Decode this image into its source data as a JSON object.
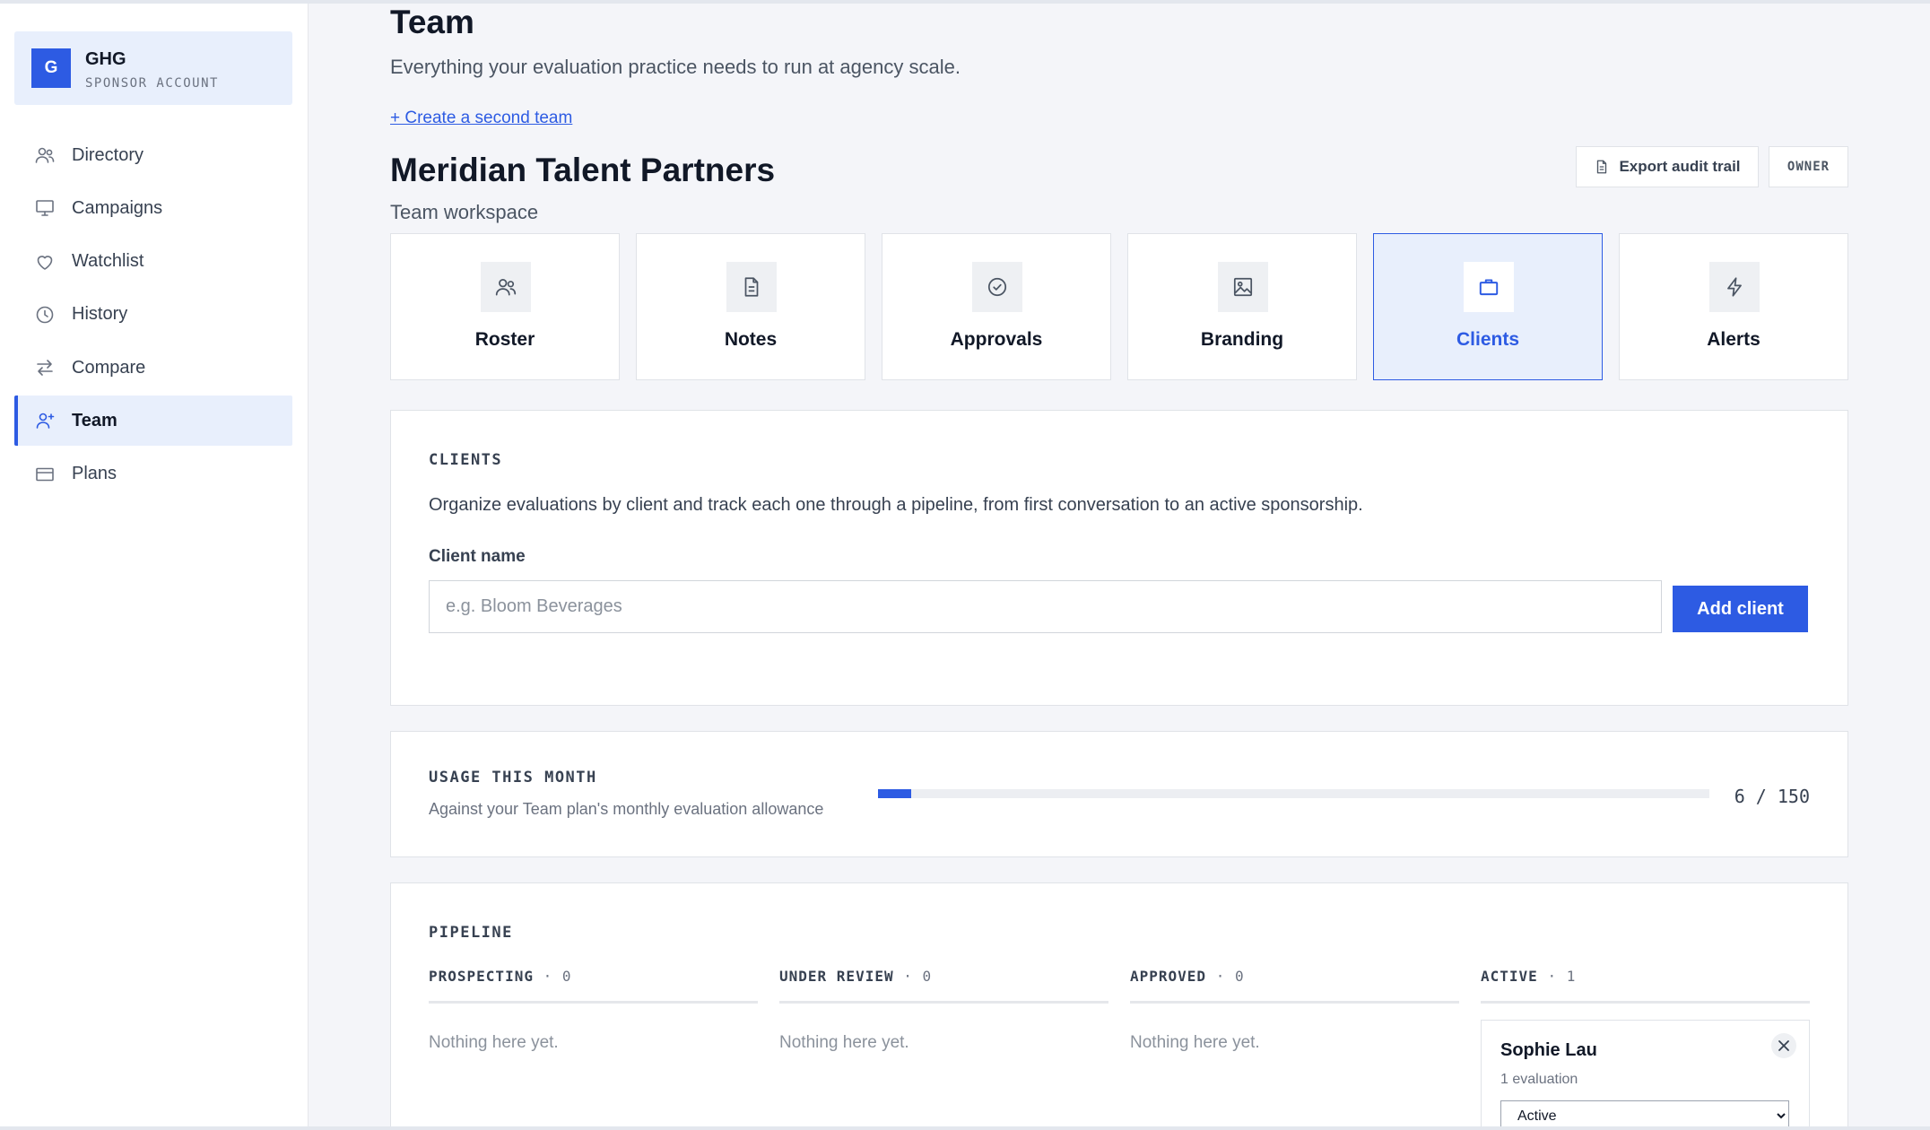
{
  "account": {
    "initial": "G",
    "name": "GHG",
    "type": "SPONSOR ACCOUNT"
  },
  "nav": [
    {
      "label": "Directory",
      "icon": "users-icon",
      "active": false
    },
    {
      "label": "Campaigns",
      "icon": "monitor-icon",
      "active": false
    },
    {
      "label": "Watchlist",
      "icon": "heart-icon",
      "active": false
    },
    {
      "label": "History",
      "icon": "clock-icon",
      "active": false
    },
    {
      "label": "Compare",
      "icon": "arrows-swap-icon",
      "active": false
    },
    {
      "label": "Team",
      "icon": "user-plus-icon",
      "active": true
    },
    {
      "label": "Plans",
      "icon": "credit-card-icon",
      "active": false
    }
  ],
  "page": {
    "title": "Team",
    "subtitle": "Everything your evaluation practice needs to run at agency scale.",
    "create_link": "+ Create a second team"
  },
  "team": {
    "name": "Meridian Talent Partners",
    "subtitle": "Team workspace",
    "export_label": "Export audit trail",
    "role_badge": "OWNER"
  },
  "tiles": [
    {
      "label": "Roster",
      "icon": "users-icon",
      "active": false
    },
    {
      "label": "Notes",
      "icon": "document-icon",
      "active": false
    },
    {
      "label": "Approvals",
      "icon": "check-circle-icon",
      "active": false
    },
    {
      "label": "Branding",
      "icon": "image-icon",
      "active": false
    },
    {
      "label": "Clients",
      "icon": "briefcase-icon",
      "active": true
    },
    {
      "label": "Alerts",
      "icon": "lightning-icon",
      "active": false
    }
  ],
  "clients": {
    "heading": "CLIENTS",
    "description": "Organize evaluations by client and track each one through a pipeline, from first conversation to an active sponsorship.",
    "field_label": "Client name",
    "input_value": "",
    "input_placeholder": "e.g. Bloom Beverages",
    "add_label": "Add client"
  },
  "usage": {
    "heading": "USAGE THIS MONTH",
    "description": "Against your Team plan's monthly evaluation allowance",
    "used": 6,
    "limit": 150,
    "display": "6 / 150"
  },
  "pipeline": {
    "heading": "PIPELINE",
    "empty_text": "Nothing here yet.",
    "columns": [
      {
        "label": "PROSPECTING",
        "count": "· 0"
      },
      {
        "label": "UNDER REVIEW",
        "count": "· 0"
      },
      {
        "label": "APPROVED",
        "count": "· 0"
      },
      {
        "label": "ACTIVE",
        "count": "· 1"
      }
    ],
    "active_card": {
      "name": "Sophie Lau",
      "evaluations": "1 evaluation",
      "status": "Active"
    }
  },
  "colors": {
    "accent": "#2d5be3",
    "accent_bg": "#e8effc",
    "page_bg": "#f4f5f9"
  }
}
